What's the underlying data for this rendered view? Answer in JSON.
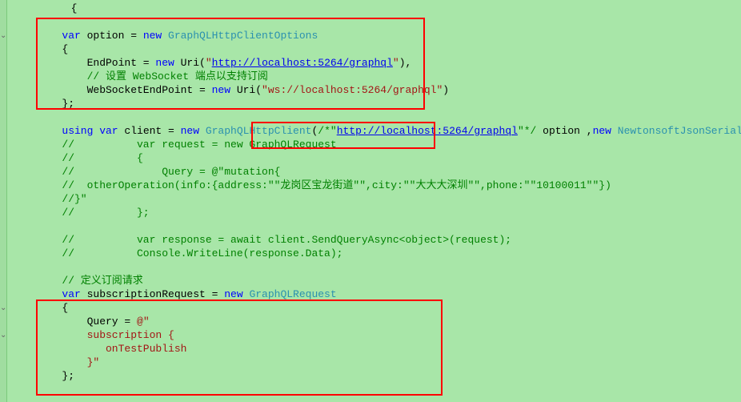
{
  "lines": {
    "l1": "    {",
    "l3_var": "var",
    "l3_option": " option = ",
    "l3_new": "new",
    "l3_type": " GraphQLHttpClientOptions",
    "l4": "{",
    "l5_a": "    EndPoint = ",
    "l5_new": "new",
    "l5_b": " Uri(",
    "l5_str1": "\"",
    "l5_url": "http://localhost:5264/graphql",
    "l5_str2": "\"",
    "l5_c": "),",
    "l6_comment": "    // 设置 WebSocket 端点以支持订阅",
    "l7_a": "    WebSocketEndPoint = ",
    "l7_new": "new",
    "l7_b": " Uri(",
    "l7_str": "\"ws://localhost:5264/graphql\"",
    "l7_c": ")",
    "l8": "};",
    "l10_using": "using var",
    "l10_a": " client = ",
    "l10_new": "new",
    "l10_type": " GraphQLHttpClient",
    "l10_b": "(",
    "l10_cmt1": "/*\"",
    "l10_url": "http://localhost:5264/graphql",
    "l10_cmt2": "\"*/",
    "l10_c": " option ,",
    "l10_new2": "new",
    "l10_type2": " NewtonsoftJsonSerializer",
    "l10_d": "());",
    "l11": "//          var request = new GraphQLRequest",
    "l12": "//          {",
    "l13": "//              Query = @\"mutation{",
    "l14": "//  otherOperation(info:{address:\"\"龙岗区宝龙街道\"\",city:\"\"大大大深圳\"\",phone:\"\"10100011\"\"})",
    "l15": "//}\"",
    "l16": "//          };",
    "l18": "//          var response = await client.SendQueryAsync<object>(request);",
    "l19": "//          Console.WriteLine(response.Data);",
    "l21_comment": "// 定义订阅请求",
    "l22_var": "var",
    "l22_a": " subscriptionRequest = ",
    "l22_new": "new",
    "l22_type": " GraphQLRequest",
    "l23": "{",
    "l24_a": "    Query = ",
    "l24_at": "@\"",
    "l25": "    subscription {",
    "l26": "       onTestPublish",
    "l27": "    }\"",
    "l28": "};"
  }
}
